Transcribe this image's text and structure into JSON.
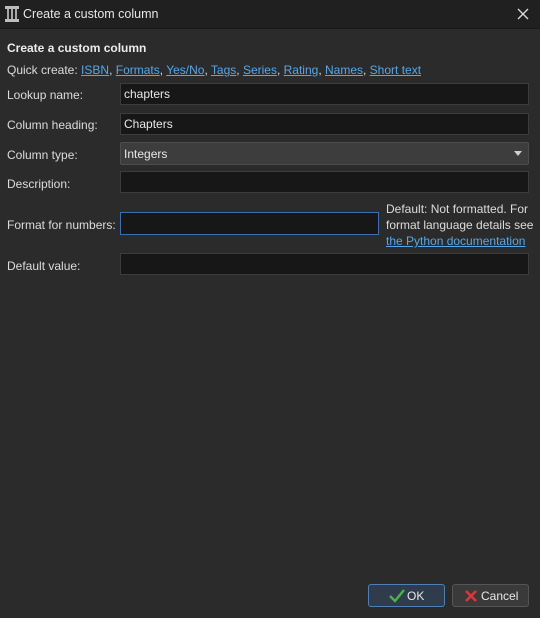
{
  "window": {
    "title": "Create a custom column",
    "app_icon": "calibre-library-icon",
    "close_icon": "close-icon"
  },
  "dialog": {
    "heading": "Create a custom column",
    "quick_create": {
      "label": "Quick create:",
      "items": [
        "ISBN",
        "Formats",
        "Yes/No",
        "Tags",
        "Series",
        "Rating",
        "Names",
        "Short text"
      ]
    }
  },
  "fields": {
    "lookup_name": {
      "label": "Lookup name:",
      "value": "chapters"
    },
    "column_heading": {
      "label": "Column heading:",
      "value": "Chapters"
    },
    "column_type": {
      "label": "Column type:",
      "value": "Integers"
    },
    "description": {
      "label": "Description:",
      "value": ""
    },
    "format_numbers": {
      "label": "Format for numbers:",
      "value": "",
      "help_text": "Default: Not formatted. For format language details see",
      "help_link": "the Python documentation"
    },
    "default_value": {
      "label": "Default value:",
      "value": ""
    }
  },
  "buttons": {
    "ok": "OK",
    "cancel": "Cancel"
  },
  "colors": {
    "background": "#2b2b2b",
    "link": "#56a7e9",
    "ok_check": "#45b649",
    "cancel_x": "#d9363e"
  }
}
